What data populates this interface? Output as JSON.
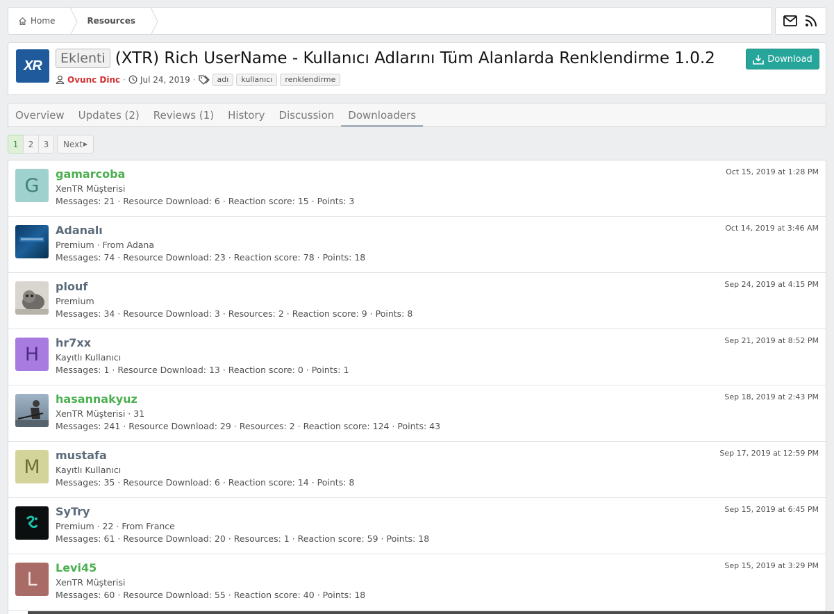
{
  "breadcrumb": {
    "home": "Home",
    "current": "Resources"
  },
  "resource": {
    "logo_text": "XR",
    "prefix": "Eklenti",
    "title": "(XTR) Rich UserName - Kullanıcı Adlarını Tüm Alanlarda Renklendirme 1.0.2",
    "author": "Ovunc Dinc",
    "date": "Jul 24, 2019",
    "tags": [
      "adı",
      "kullanıcı",
      "renklendirme"
    ],
    "download_label": "Download"
  },
  "tabs": [
    {
      "label": "Overview"
    },
    {
      "label": "Updates (2)"
    },
    {
      "label": "Reviews (1)"
    },
    {
      "label": "History"
    },
    {
      "label": "Discussion"
    },
    {
      "label": "Downloaders"
    }
  ],
  "pagination": {
    "pages": [
      "1",
      "2",
      "3"
    ],
    "current": "1",
    "next": "Next"
  },
  "colors": {
    "accent_green": "#4caf50",
    "username_gray": "#5c6b7a",
    "author_red": "#d32f2f",
    "download_teal": "#26a69a"
  },
  "downloaders": [
    {
      "name": "gamarcoba",
      "name_color": "#4caf50",
      "avatar_letter": "G",
      "avatar_bg": "#9fd1cf",
      "avatar_fg": "#3f7f7c",
      "title": "XenTR Müşterisi",
      "stats": "Messages: 21 · Resource Download: 6 · Reaction score: 15 · Points: 3",
      "date": "Oct 15, 2019 at 1:28 PM"
    },
    {
      "name": "Adanalı",
      "name_color": "#5c6b7a",
      "avatar_letter": "",
      "avatar_bg": "#0b3a66",
      "avatar_fg": "#7fa6cc",
      "title": "Premium · From Adana",
      "stats": "Messages: 74 · Resource Download: 23 · Reaction score: 78 · Points: 18",
      "date": "Oct 14, 2019 at 3:46 AM"
    },
    {
      "name": "plouf",
      "name_color": "#5c6b7a",
      "avatar_letter": "",
      "avatar_bg": "#c9c6c0",
      "avatar_fg": "#555",
      "title": "Premium",
      "stats": "Messages: 34 · Resource Download: 3 · Resources: 2 · Reaction score: 9 · Points: 8",
      "date": "Sep 24, 2019 at 4:15 PM"
    },
    {
      "name": "hr7xx",
      "name_color": "#5c6b7a",
      "avatar_letter": "H",
      "avatar_bg": "#a77be0",
      "avatar_fg": "#4a2d80",
      "title": "Kayıtlı Kullanıcı",
      "stats": "Messages: 1 · Resource Download: 13 · Reaction score: 0 · Points: 1",
      "date": "Sep 21, 2019 at 8:52 PM"
    },
    {
      "name": "hasannakyuz",
      "name_color": "#4caf50",
      "avatar_letter": "",
      "avatar_bg": "#7d96ad",
      "avatar_fg": "#333",
      "title": "XenTR Müşterisi · 31",
      "stats": "Messages: 241 · Resource Download: 29 · Resources: 2 · Reaction score: 124 · Points: 43",
      "date": "Sep 18, 2019 at 2:43 PM"
    },
    {
      "name": "mustafa",
      "name_color": "#5c6b7a",
      "avatar_letter": "M",
      "avatar_bg": "#d3d49a",
      "avatar_fg": "#6e6f37",
      "title": "Kayıtlı Kullanıcı",
      "stats": "Messages: 35 · Resource Download: 6 · Reaction score: 14 · Points: 8",
      "date": "Sep 17, 2019 at 12:59 PM"
    },
    {
      "name": "SyTry",
      "name_color": "#5c6b7a",
      "avatar_letter": "",
      "avatar_bg": "#0b0f0f",
      "avatar_fg": "#19c2a8",
      "title": "Premium · 22 · From France",
      "stats": "Messages: 61 · Resource Download: 20 · Resources: 1 · Reaction score: 59 · Points: 18",
      "date": "Sep 15, 2019 at 6:45 PM"
    },
    {
      "name": "Levi45",
      "name_color": "#4caf50",
      "avatar_letter": "L",
      "avatar_bg": "#a86b66",
      "avatar_fg": "#f2e3e1",
      "title": "XenTR Müşterisi",
      "stats": "Messages: 60 · Resource Download: 55 · Reaction score: 40 · Points: 18",
      "date": "Sep 15, 2019 at 3:29 PM"
    }
  ]
}
